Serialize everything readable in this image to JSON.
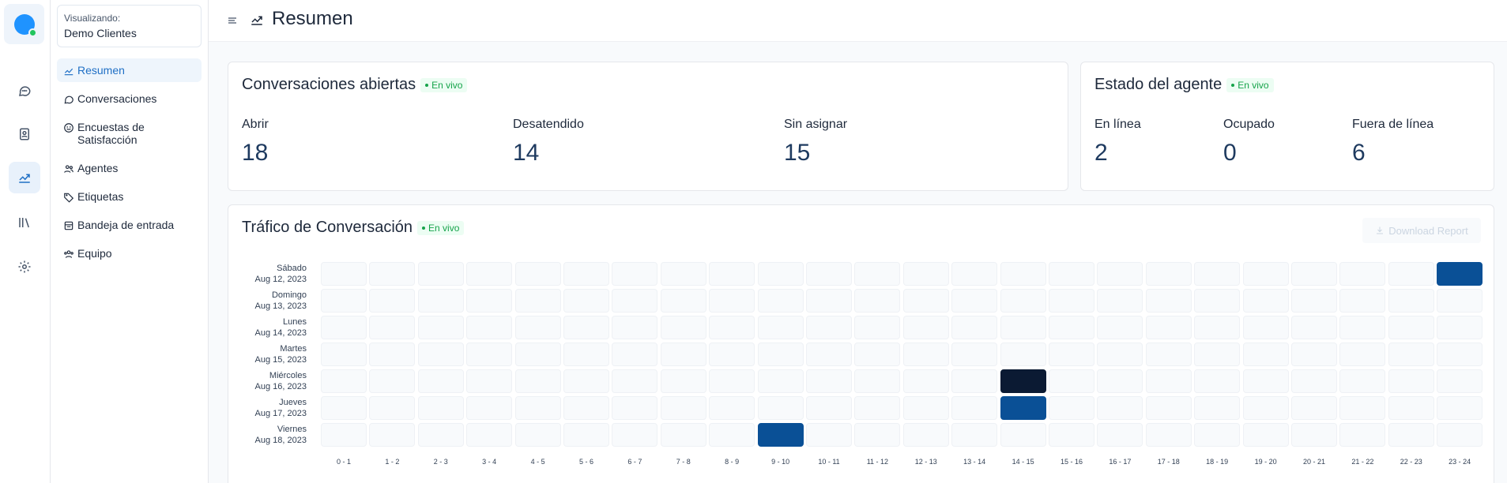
{
  "sidebar": {
    "viewing_label": "Visualizando:",
    "account_name": "Demo Clientes",
    "items": [
      {
        "label": "Resumen",
        "icon": "chart-icon",
        "active": true
      },
      {
        "label": "Conversaciones",
        "icon": "chat-icon"
      },
      {
        "label": "Encuestas de Satisfacción",
        "icon": "smile-icon"
      },
      {
        "label": "Agentes",
        "icon": "users-icon"
      },
      {
        "label": "Etiquetas",
        "icon": "tag-icon"
      },
      {
        "label": "Bandeja de entrada",
        "icon": "inbox-icon"
      },
      {
        "label": "Equipo",
        "icon": "team-icon"
      }
    ]
  },
  "rail": {
    "items": [
      "conversations-icon",
      "contacts-icon",
      "reports-icon",
      "library-icon",
      "settings-icon"
    ],
    "active": "reports-icon"
  },
  "header": {
    "title": "Resumen"
  },
  "conversations_card": {
    "title": "Conversaciones abiertas",
    "live": "En vivo",
    "metrics": [
      {
        "label": "Abrir",
        "value": "18"
      },
      {
        "label": "Desatendido",
        "value": "14"
      },
      {
        "label": "Sin asignar",
        "value": "15"
      }
    ]
  },
  "agent_card": {
    "title": "Estado del agente",
    "live": "En vivo",
    "metrics": [
      {
        "label": "En línea",
        "value": "2"
      },
      {
        "label": "Ocupado",
        "value": "0"
      },
      {
        "label": "Fuera de línea",
        "value": "6"
      }
    ]
  },
  "traffic_card": {
    "title": "Tráfico de Conversación",
    "live": "En vivo",
    "download_label": "Download Report"
  },
  "colors": {
    "accent": "#1f93ff",
    "heat_medium": "#0a5096",
    "heat_high": "#0b1a33",
    "heat_empty": "#f8fafc"
  },
  "chart_data": {
    "type": "heatmap",
    "rows": [
      {
        "day": "Sábado",
        "date": "Aug 12, 2023"
      },
      {
        "day": "Domingo",
        "date": "Aug 13, 2023"
      },
      {
        "day": "Lunes",
        "date": "Aug 14, 2023"
      },
      {
        "day": "Martes",
        "date": "Aug 15, 2023"
      },
      {
        "day": "Miércoles",
        "date": "Aug 16, 2023"
      },
      {
        "day": "Jueves",
        "date": "Aug 17, 2023"
      },
      {
        "day": "Viernes",
        "date": "Aug 18, 2023"
      }
    ],
    "columns": [
      "0 - 1",
      "1 - 2",
      "2 - 3",
      "3 - 4",
      "4 - 5",
      "5 - 6",
      "6 - 7",
      "7 - 8",
      "8 - 9",
      "9 - 10",
      "10 - 11",
      "11 - 12",
      "12 - 13",
      "13 - 14",
      "14 - 15",
      "15 - 16",
      "16 - 17",
      "17 - 18",
      "18 - 19",
      "19 - 20",
      "20 - 21",
      "21 - 22",
      "22 - 23",
      "23 - 24"
    ],
    "values": [
      [
        0,
        0,
        0,
        0,
        0,
        0,
        0,
        0,
        0,
        0,
        0,
        0,
        0,
        0,
        0,
        0,
        0,
        0,
        0,
        0,
        0,
        0,
        0,
        1
      ],
      [
        0,
        0,
        0,
        0,
        0,
        0,
        0,
        0,
        0,
        0,
        0,
        0,
        0,
        0,
        0,
        0,
        0,
        0,
        0,
        0,
        0,
        0,
        0,
        0
      ],
      [
        0,
        0,
        0,
        0,
        0,
        0,
        0,
        0,
        0,
        0,
        0,
        0,
        0,
        0,
        0,
        0,
        0,
        0,
        0,
        0,
        0,
        0,
        0,
        0
      ],
      [
        0,
        0,
        0,
        0,
        0,
        0,
        0,
        0,
        0,
        0,
        0,
        0,
        0,
        0,
        0,
        0,
        0,
        0,
        0,
        0,
        0,
        0,
        0,
        0
      ],
      [
        0,
        0,
        0,
        0,
        0,
        0,
        0,
        0,
        0,
        0,
        0,
        0,
        0,
        0,
        2,
        0,
        0,
        0,
        0,
        0,
        0,
        0,
        0,
        0
      ],
      [
        0,
        0,
        0,
        0,
        0,
        0,
        0,
        0,
        0,
        0,
        0,
        0,
        0,
        0,
        1,
        0,
        0,
        0,
        0,
        0,
        0,
        0,
        0,
        0
      ],
      [
        0,
        0,
        0,
        0,
        0,
        0,
        0,
        0,
        0,
        1,
        0,
        0,
        0,
        0,
        0,
        0,
        0,
        0,
        0,
        0,
        0,
        0,
        0,
        0
      ]
    ]
  }
}
